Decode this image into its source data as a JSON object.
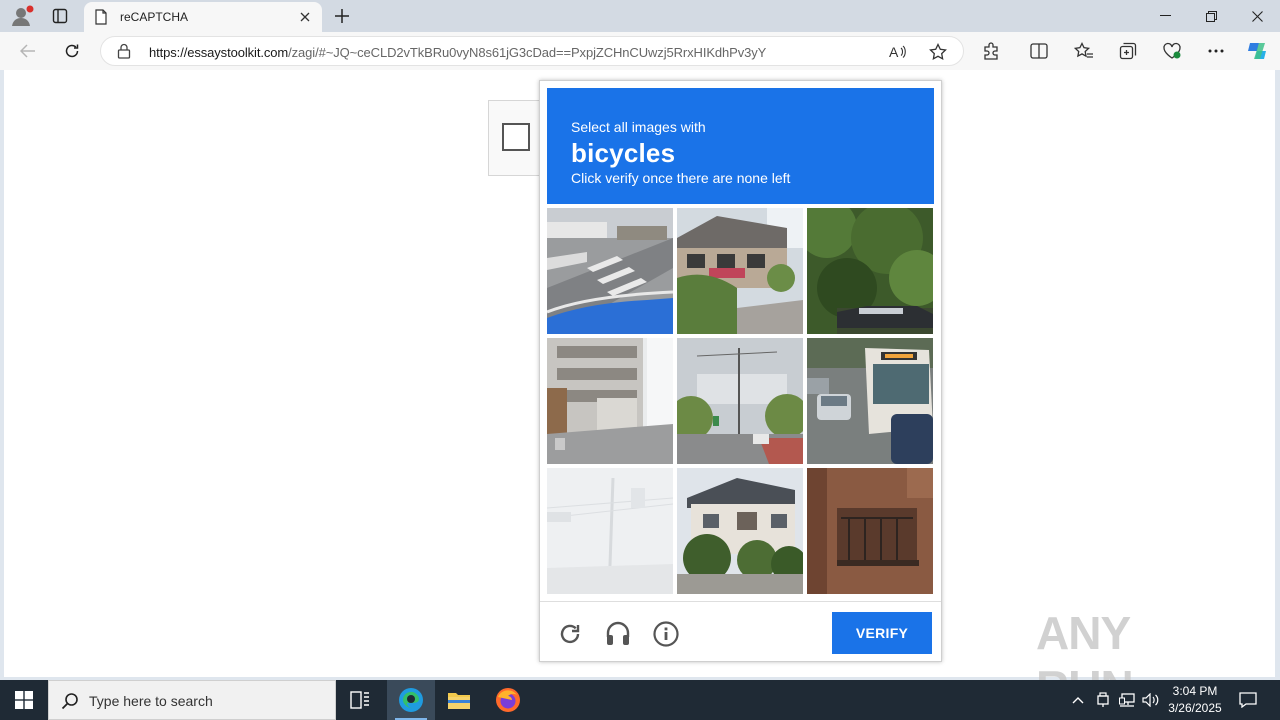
{
  "browser": {
    "tab_title": "reCAPTCHA",
    "url_host": "https://essaystoolkit.com",
    "url_path": "/zagi/#~JQ~ceCLD2vTkBRu0vyN8s61jG3cDad==PxpjZCHnCUwzj5RrxHIKdhPv3yY"
  },
  "captcha": {
    "instruction": "Select all images with",
    "target": "bicycles",
    "hint": "Click verify once there are none left",
    "verify_label": "VERIFY",
    "tiles": [
      "tile-1",
      "tile-2",
      "tile-3",
      "tile-4",
      "tile-5",
      "tile-6",
      "tile-7",
      "tile-8",
      "tile-9"
    ]
  },
  "watermark": "ANY RUN",
  "taskbar": {
    "search_placeholder": "Type here to search",
    "time": "3:04 PM",
    "date": "3/26/2025"
  },
  "colors": {
    "accent": "#1a73e8",
    "taskbar": "#1f2a35",
    "tabbar": "#d3dae3"
  }
}
